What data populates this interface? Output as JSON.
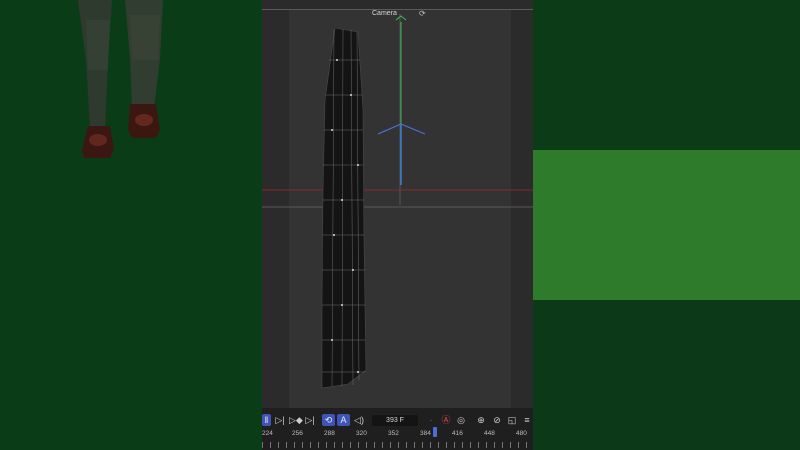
{
  "viewport": {
    "camera_label": "Camera",
    "camera_icon": "camera-refresh-icon"
  },
  "timeline": {
    "current_frame": "393 F",
    "ruler_labels": [
      "224",
      "256",
      "288",
      "320",
      "352",
      "384",
      "416",
      "448",
      "480"
    ],
    "icons": [
      "pause-icon",
      "step-forward-icon",
      "next-keyframe-icon",
      "jump-to-end-icon",
      "loop-icon",
      "auto-key-icon",
      "audio-icon",
      "record-icon",
      "autokey-a-icon",
      "settings-icon",
      "target-icon",
      "transform-icon",
      "screen-icon",
      "more-icon"
    ]
  },
  "colors": {
    "green_screen_dark": "#0b3c18",
    "green_screen_bright": "#2f7b2c",
    "viewport_bg": "#2b2b2b",
    "accent_blue": "#3f55b5"
  }
}
